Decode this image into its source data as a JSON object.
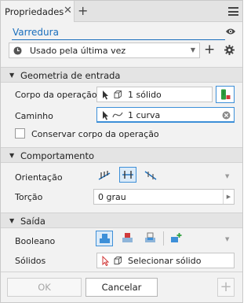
{
  "tab": {
    "title": "Propriedades",
    "close": "✕",
    "add": "+"
  },
  "command": {
    "title": "Varredura"
  },
  "preset": {
    "value": "Usado pela última vez"
  },
  "sections": {
    "input": {
      "title": "Geometria de entrada"
    },
    "behavior": {
      "title": "Comportamento"
    },
    "output": {
      "title": "Saída"
    }
  },
  "input": {
    "profile_label": "Corpo da operação",
    "profile_value": "1 sólido",
    "path_label": "Caminho",
    "path_value": "1 curva",
    "keep_label": "Conservar corpo da operação",
    "keep_checked": false
  },
  "behavior": {
    "orientation_label": "Orientação",
    "twist_label": "Torção",
    "twist_value": "0 grau"
  },
  "output": {
    "boolean_label": "Booleano",
    "solids_label": "Sólidos",
    "solids_value": "Selecionar sólido"
  },
  "footer": {
    "ok": "OK",
    "cancel": "Cancelar"
  },
  "colors": {
    "accent": "#1a6fbd",
    "active_bg": "#dcebf8",
    "active_border": "#3d8fd8",
    "pick_green": "#2e9e3e",
    "pick_red": "#d23a3a"
  }
}
